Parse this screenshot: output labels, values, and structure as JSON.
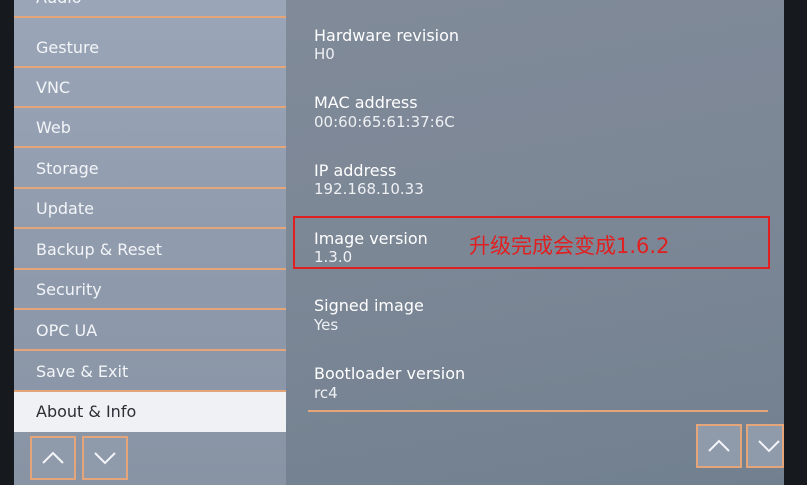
{
  "sidebar": {
    "items": [
      {
        "label": "Audio",
        "active": false
      },
      {
        "label": "Gesture",
        "active": false
      },
      {
        "label": "VNC",
        "active": false
      },
      {
        "label": "Web",
        "active": false
      },
      {
        "label": "Storage",
        "active": false
      },
      {
        "label": "Update",
        "active": false
      },
      {
        "label": "Backup & Reset",
        "active": false
      },
      {
        "label": "Security",
        "active": false
      },
      {
        "label": "OPC UA",
        "active": false
      },
      {
        "label": "Save & Exit",
        "active": false
      },
      {
        "label": "About & Info",
        "active": true
      }
    ]
  },
  "info": [
    {
      "label": "Hardware revision",
      "value": "H0"
    },
    {
      "label": "MAC address",
      "value": "00:60:65:61:37:6C"
    },
    {
      "label": "IP address",
      "value": "192.168.10.33"
    },
    {
      "label": "Image version",
      "value": "1.3.0"
    },
    {
      "label": "Signed image",
      "value": "Yes"
    },
    {
      "label": "Bootloader version",
      "value": "rc4"
    }
  ],
  "annotation": {
    "text": "升级完成会变成1.6.2"
  },
  "colors": {
    "accent": "#e4a57a",
    "annotation": "#e02020"
  },
  "icons": {
    "scroll_up": "chevron-up-icon",
    "scroll_down": "chevron-down-icon"
  }
}
